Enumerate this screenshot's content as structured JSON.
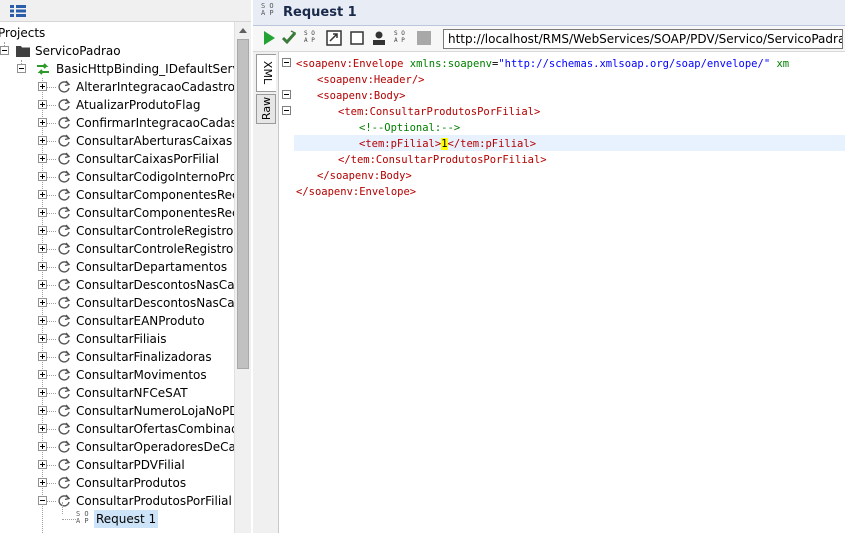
{
  "left_panel": {
    "root_label": "Projects",
    "project": "ServicoPadrao",
    "binding": "BasicHttpBinding_IDefaultService",
    "operations": [
      "AlterarIntegracaoCadastro",
      "AtualizarProdutoFlag",
      "ConfirmarIntegracaoCadastro",
      "ConsultarAberturasCaixas",
      "ConsultarCaixasPorFilial",
      "ConsultarCodigoInternoProdu",
      "ConsultarComponentesReceit",
      "ConsultarComponentesReceit",
      "ConsultarControleRegistroExp",
      "ConsultarControleRegistroExp",
      "ConsultarDepartamentos",
      "ConsultarDescontosNasCateg",
      "ConsultarDescontosNasCateg",
      "ConsultarEANProduto",
      "ConsultarFiliais",
      "ConsultarFinalizadoras",
      "ConsultarMovimentos",
      "ConsultarNFCeSAT",
      "ConsultarNumeroLojaNoPDV",
      "ConsultarOfertasCombinadas",
      "ConsultarOperadoresDeCaixa",
      "ConsultarPDVFilial",
      "ConsultarProdutos",
      "ConsultarProdutosPorFilial"
    ],
    "request": "Request 1"
  },
  "right_panel": {
    "title": "Request 1",
    "soap_logo": [
      "S O",
      "A P"
    ],
    "url": "http://localhost/RMS/WebServices/SOAP/PDV/Servico/ServicoPadrao.svc",
    "tabs": [
      "XML",
      "Raw"
    ],
    "code": {
      "l1_open": "<soapenv:Envelope",
      "l1_attr": " xmlns:soapenv",
      "l1_eq": "=",
      "l1_val": "\"http://schemas.xmlsoap.org/soap/envelope/\"",
      "l1_tail": " xm",
      "l2": "<soapenv:Header/>",
      "l3": "<soapenv:Body>",
      "l4": "<tem:ConsultarProdutosPorFilial>",
      "l5": "<!--Optional:-->",
      "l6_open": "<tem:pFilial>",
      "l6_val": "1",
      "l6_close": "</tem:pFilial>",
      "l7": "</tem:ConsultarProdutosPorFilial>",
      "l8": "</soapenv:Body>",
      "l9": "</soapenv:Envelope>"
    }
  }
}
